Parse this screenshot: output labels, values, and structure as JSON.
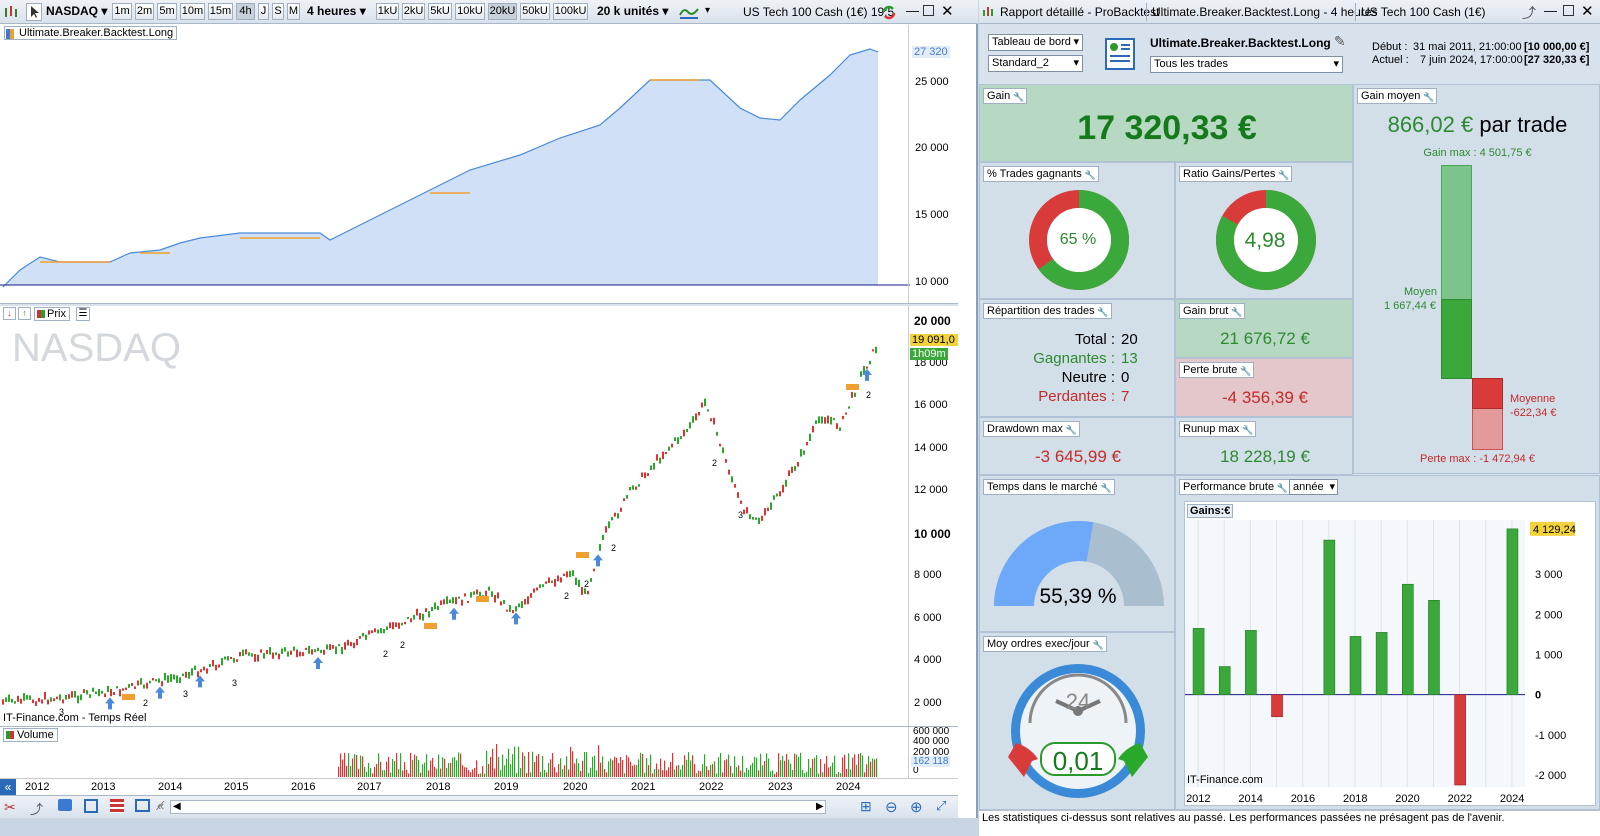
{
  "left": {
    "symbol": "NASDAQ",
    "timeframes": [
      "1m",
      "2m",
      "5m",
      "10m",
      "15m",
      "4h",
      "J",
      "S",
      "M"
    ],
    "period_select": "4 heures",
    "unit_buttons": [
      "1kU",
      "2kU",
      "5kU",
      "10kU",
      "20kU",
      "50kU",
      "100kU"
    ],
    "units_select": "20 k unités",
    "window_title": "US Tech 100 Cash (1€) 19:5",
    "equity_panel_label": "Ultimate.Breaker.Backtest.Long",
    "equity_axis": [
      "25 000",
      "20 000",
      "15 000",
      "10 000"
    ],
    "equity_last": "27 320",
    "price_panel_label": "Prix",
    "watermark": "NASDAQ",
    "price_axis": [
      "20 000",
      "18 000",
      "16 000",
      "14 000",
      "12 000",
      "10 000",
      "8 000",
      "6 000",
      "4 000",
      "2 000"
    ],
    "price_last": "19 091,0",
    "countdown": "1h09m",
    "source_text": "IT-Finance.com - Temps Réel",
    "volume_label": "Volume",
    "volume_axis": [
      "600 000",
      "400 000",
      "200 000",
      "0"
    ],
    "volume_last": "162 118",
    "years": [
      "2012",
      "2013",
      "2014",
      "2015",
      "2016",
      "2017",
      "2018",
      "2019",
      "2020",
      "2021",
      "2022",
      "2023",
      "2024"
    ],
    "trade_markers": [
      "3",
      "2",
      "3",
      "3",
      "2",
      "2",
      "2",
      "2",
      "2",
      "3",
      "2",
      "2"
    ]
  },
  "right": {
    "title_tabs": [
      "Rapport détaillé - ProBacktest",
      "Ultimate.Breaker.Backtest.Long - 4 heures",
      "US Tech 100 Cash (1€)"
    ],
    "view_select": "Tableau de bord",
    "layout_select": "Standard_2",
    "strategy_name": "Ultimate.Breaker.Backtest.Long",
    "trades_select": "Tous les trades",
    "debut_label": "Début :",
    "debut_value": "31 mai 2011, 21:00:00",
    "debut_capital": "[10 000,00 €]",
    "actuel_label": "Actuel :",
    "actuel_value": "7 juin 2024, 17:00:00",
    "actuel_capital": "[27 320,33 €]",
    "gain_label": "Gain",
    "gain_value": "17 320,33 €",
    "gain_moyen_label": "Gain moyen",
    "gain_moyen_value": "866,02 €",
    "gain_moyen_suffix": "par trade",
    "gain_max_text": "Gain max : 4 501,75 €",
    "moyen_label": "Moyen",
    "moyen_value": "1 667,44 €",
    "moyenne_label": "Moyenne",
    "moyenne_value": "-622,34 €",
    "perte_max_text": "Perte max : -1 472,94 €",
    "pct_gagnants_label": "% Trades gagnants",
    "pct_gagnants_value": "65 %",
    "pct_gagnants_fraction": 0.65,
    "ratio_label": "Ratio Gains/Pertes",
    "ratio_value": "4,98",
    "ratio_fraction": 0.83,
    "repartition_label": "Répartition des trades",
    "total_label": "Total :",
    "total_value": "20",
    "gagnantes_label": "Gagnantes :",
    "gagnantes_value": "13",
    "neutre_label": "Neutre :",
    "neutre_value": "0",
    "perdantes_label": "Perdantes :",
    "perdantes_value": "7",
    "gain_brut_label": "Gain brut",
    "gain_brut_value": "21 676,72 €",
    "perte_brute_label": "Perte brute",
    "perte_brute_value": "-4 356,39 €",
    "drawdown_label": "Drawdown max",
    "drawdown_value": "-3 645,99 €",
    "runup_label": "Runup max",
    "runup_value": "18 228,19 €",
    "temps_label": "Temps dans le marché",
    "temps_value": "55,39 %",
    "temps_fraction": 0.5539,
    "moy_ordres_label": "Moy ordres exec/jour",
    "moy_ordres_value": "0,01",
    "clock_number": "24",
    "perf_label": "Performance brute",
    "perf_select": "année",
    "perf_chart_title": "Gains:€",
    "perf_last": "4 129,24",
    "perf_source": "IT-Finance.com",
    "footer_text": "Les statistiques ci-dessus sont relatives au passé. Les performances passées ne présagent pas de l'avenir."
  },
  "chart_data": {
    "type": "bar",
    "title": "Gains:€",
    "x": [
      2012,
      2013,
      2014,
      2015,
      2016,
      2017,
      2018,
      2019,
      2020,
      2021,
      2022,
      2023,
      2024
    ],
    "categories": [
      "2012",
      "2013",
      "2014",
      "2015",
      "2016",
      "2017",
      "2018",
      "2019",
      "2020",
      "2021",
      "2022",
      "2023",
      "2024"
    ],
    "values": [
      1650,
      700,
      1600,
      -550,
      0,
      3850,
      1450,
      1550,
      2750,
      2350,
      -2250,
      0,
      4129.24
    ],
    "ylim": [
      -2300,
      4350
    ],
    "yticks": [
      "3 000",
      "2 000",
      "1 000",
      "0",
      "-1 000",
      "-2 000"
    ],
    "xticks": [
      "2012",
      "2014",
      "2016",
      "2018",
      "2020",
      "2022",
      "2024"
    ],
    "colors": {
      "positive": "#3aa83a",
      "negative": "#d93a3a"
    }
  }
}
